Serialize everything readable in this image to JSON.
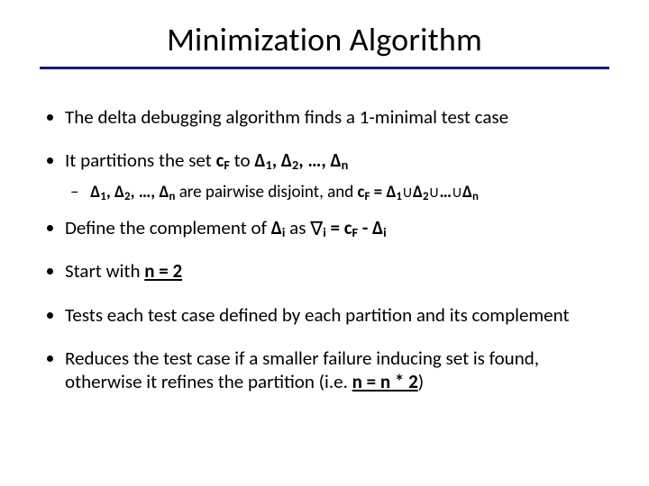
{
  "title": "Minimization Algorithm",
  "bullets": {
    "b1": "The delta debugging algorithm finds a 1-minimal test case",
    "b2_pre": "It partitions the set ",
    "b2_cf": "c",
    "b2_cf_sub": "F",
    "b2_mid": " to ",
    "b2_d": "Δ",
    "b2_sub1": "1",
    "b2_sep": ", ",
    "b2_sub2": "2",
    "b2_ell": ", …, ",
    "b2_subn": "n",
    "b2s_pre": "are pairwise disjoint, and ",
    "b2s_eq": " = ",
    "union": "U",
    "b2s_ellipsis": "…",
    "b3_pre": "Define the complement of ",
    "b3_di": "Δ",
    "b3_i": "i",
    "b3_mid": "  as ",
    "nabla": "∇",
    "b3_eq": " = ",
    "b3_minus": " - ",
    "b4_pre": "Start with ",
    "b4_eq": "n = 2",
    "b5": "Tests each test case defined by each partition and its complement",
    "b6_pre": "Reduces the test case if a smaller failure inducing set is found, otherwise it refines the partition (i.e. ",
    "b6_eq": "n = n * 2",
    "b6_post": ")"
  }
}
